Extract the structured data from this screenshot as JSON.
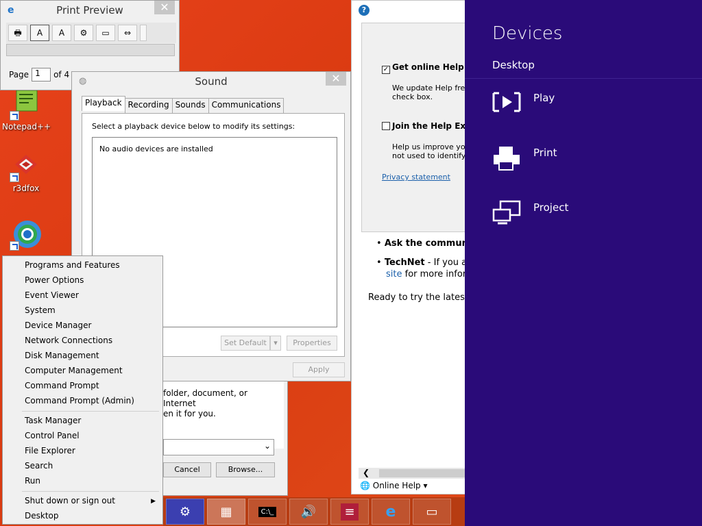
{
  "desktop": {
    "icons": [
      {
        "label": "Notepad++",
        "icon": "notepad-plus-plus-icon"
      },
      {
        "label": "r3dfox",
        "icon": "r3dfox-icon"
      },
      {
        "label": "",
        "icon": "chrome-icon"
      }
    ]
  },
  "print_preview": {
    "title": "Print Preview",
    "close": "✕",
    "page_label": "Page",
    "page_value": "1",
    "page_total": "of 4"
  },
  "sound": {
    "title": "Sound",
    "close": "✕",
    "tabs": [
      "Playback",
      "Recording",
      "Sounds",
      "Communications"
    ],
    "prompt": "Select a playback device below to modify its settings:",
    "empty_message": "No audio devices are installed",
    "set_default": "Set Default",
    "properties": "Properties",
    "apply": "Apply"
  },
  "run": {
    "close": "✕",
    "desc_line1": "folder, document, or Internet",
    "desc_line2": "en it for you.",
    "cancel": "Cancel",
    "browse": "Browse..."
  },
  "help": {
    "get_online_help": "Get online Help (re",
    "online_desc_1": "We update Help freque",
    "online_desc_2": "check box.",
    "join": "Join the Help Expe",
    "join_desc_1": "Help us improve your H",
    "join_desc_2": "not used to identify or c",
    "privacy": "Privacy statement",
    "ask_bullet": "Ask the community",
    "technet_bullet": "TechNet",
    "technet_rest": " - If you are",
    "site": "site",
    "site_rest": " for more inform",
    "ready": "Ready to try the latest ve",
    "online_help": "Online Help"
  },
  "charms": {
    "title": "Devices",
    "subtitle": "Desktop",
    "devices": [
      {
        "label": "Play",
        "icon": "play-icon"
      },
      {
        "label": "Print",
        "icon": "printer-icon"
      },
      {
        "label": "Project",
        "icon": "project-icon"
      }
    ]
  },
  "winx": {
    "items": [
      "Programs and Features",
      "Power Options",
      "Event Viewer",
      "System",
      "Device Manager",
      "Network Connections",
      "Disk Management",
      "Computer Management",
      "Command Prompt",
      "Command Prompt (Admin)",
      "Task Manager",
      "Control Panel",
      "File Explorer",
      "Search",
      "Run",
      "Shut down or sign out",
      "Desktop"
    ]
  },
  "colors": {
    "desktop_bg": "#e2511d",
    "charms_bg": "#2a0b79",
    "taskbar_bg": "#b73c12"
  }
}
